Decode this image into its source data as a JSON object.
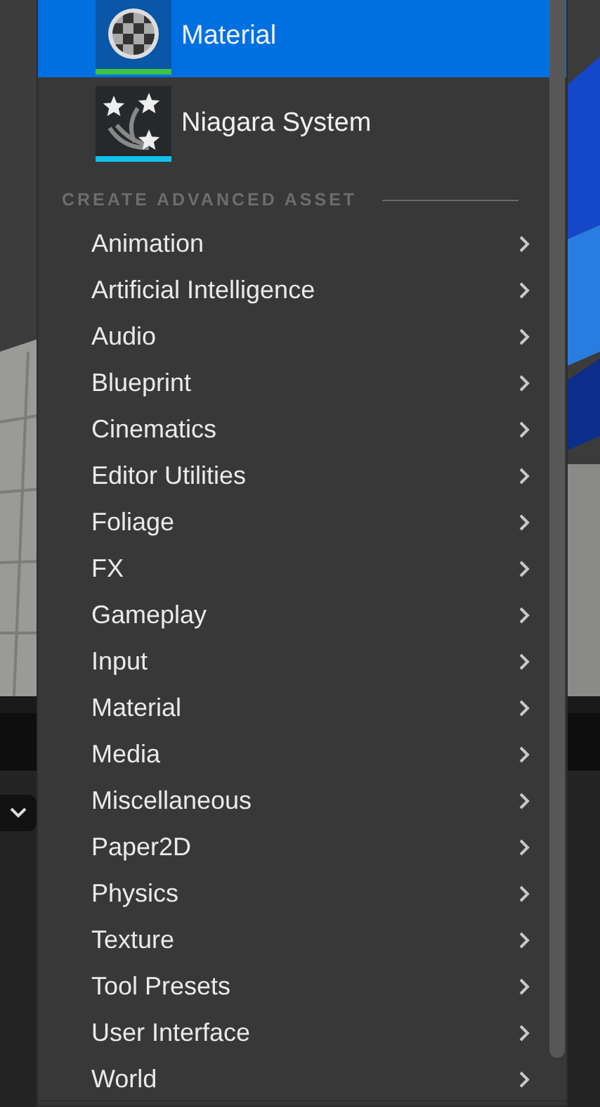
{
  "menu": {
    "assets": [
      {
        "label": "Material",
        "selected": true,
        "color": "#3ec241"
      },
      {
        "label": "Niagara System",
        "selected": false,
        "color": "#12c0f0"
      }
    ],
    "section_header": "CREATE ADVANCED ASSET",
    "categories": [
      "Animation",
      "Artificial Intelligence",
      "Audio",
      "Blueprint",
      "Cinematics",
      "Editor Utilities",
      "Foliage",
      "FX",
      "Gameplay",
      "Input",
      "Material",
      "Media",
      "Miscellaneous",
      "Paper2D",
      "Physics",
      "Texture",
      "Tool Presets",
      "User Interface",
      "World"
    ]
  }
}
